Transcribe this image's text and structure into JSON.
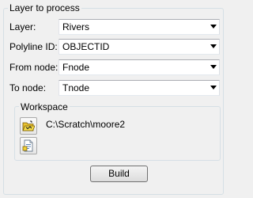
{
  "layer_group": {
    "title": "Layer to process",
    "rows": [
      {
        "label": "Layer:",
        "value": "Rivers"
      },
      {
        "label": "Polyline ID:",
        "value": "OBJECTID"
      },
      {
        "label": "From node:",
        "value": "Fnode"
      },
      {
        "label": "To node:",
        "value": "Tnode"
      }
    ]
  },
  "workspace": {
    "title": "Workspace",
    "path": "C:\\Scratch\\moore2",
    "open_icon": "open-folder-icon",
    "new_icon": "new-document-icon"
  },
  "actions": {
    "build_label": "Build"
  },
  "colors": {
    "background": "#f0f0f0",
    "group_border": "#d5dfe5",
    "folder_yellow": "#f2d336"
  }
}
